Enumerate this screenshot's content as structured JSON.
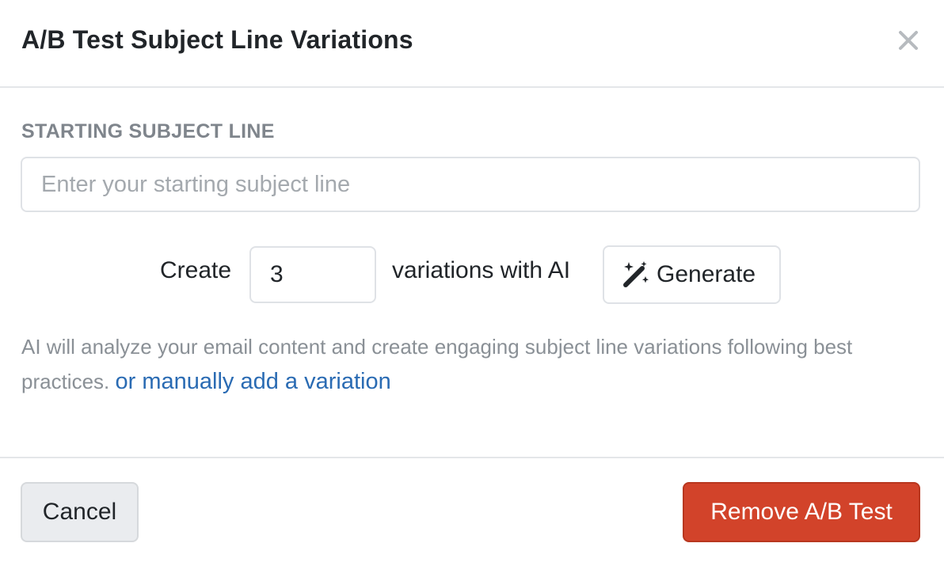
{
  "dialog": {
    "title": "A/B Test Subject Line Variations",
    "close_icon": "close-icon"
  },
  "starting_subject": {
    "label": "STARTING SUBJECT LINE",
    "placeholder": "Enter your starting subject line",
    "value": ""
  },
  "generator": {
    "prefix_label": "Create",
    "count_value": "3",
    "suffix_label": "variations with AI",
    "generate_label": "Generate",
    "generate_icon": "magic-wand-icon"
  },
  "help": {
    "text": "AI will analyze your email content and create engaging subject line variations following best practices.",
    "link_label": "or manually add a variation"
  },
  "footer": {
    "cancel_label": "Cancel",
    "remove_label": "Remove A/B Test"
  },
  "colors": {
    "danger": "#d2432a",
    "link": "#2a6bb3",
    "muted_label": "#7f858c",
    "cancel_bg": "#eaecef"
  }
}
